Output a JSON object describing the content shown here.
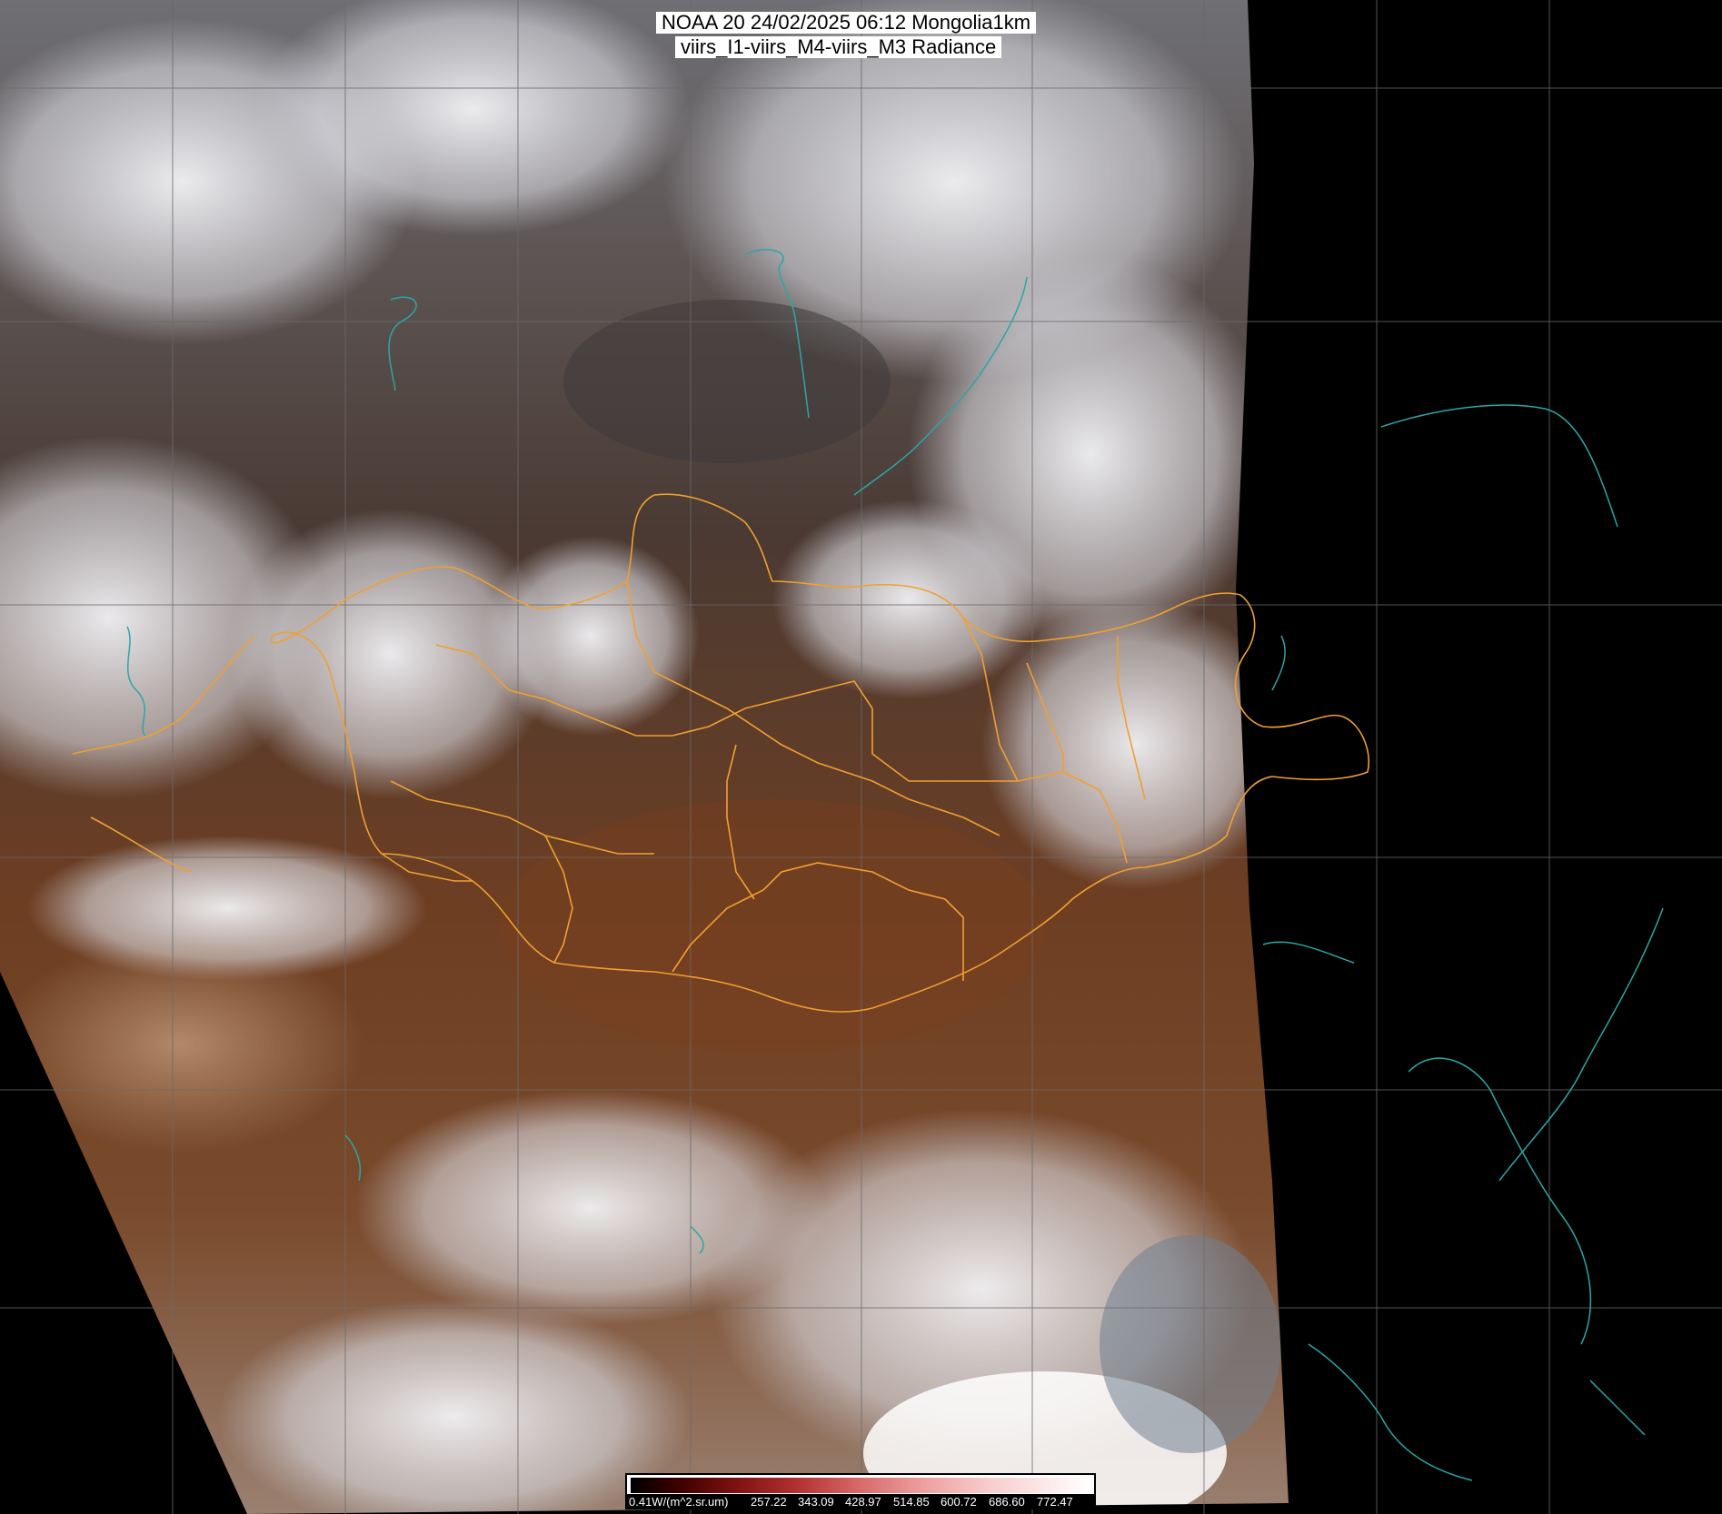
{
  "title": {
    "line1": "NOAA 20 24/02/2025 06:12 Mongolia1km",
    "line2": "viirs_I1-viirs_M4-viirs_M3 Radiance"
  },
  "colorbar": {
    "labels": [
      "0.41W/(m^2.sr.um)",
      "257.22",
      "343.09",
      "428.97",
      "514.85",
      "600.72",
      "686.60",
      "772.47"
    ]
  },
  "colors": {
    "border": "#f0a030",
    "coast": "#2aa7a7",
    "grid": "#6a6a6a",
    "background": "#000000"
  }
}
